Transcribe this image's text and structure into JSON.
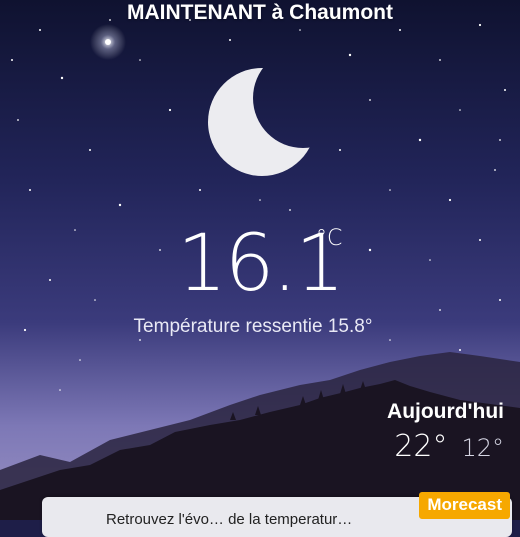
{
  "header": {
    "location_title": "MAINTENANT à Chaumont"
  },
  "current": {
    "temperature": "16.1",
    "unit": "°C",
    "feels_like": "Température ressentie 15.8°",
    "icon": "moon-icon"
  },
  "today": {
    "label": "Aujourd'hui",
    "high": "22°",
    "low": "12°"
  },
  "card": {
    "text": "Retrouvez l'évo… de la temperatur…"
  },
  "brand": {
    "label": "Morecast",
    "color": "#f6a800"
  },
  "colors": {
    "sky_top": "#0f1230",
    "sky_mid": "#2e2f6c",
    "sky_low": "#7d78b6",
    "mountains": "#1a1422"
  }
}
